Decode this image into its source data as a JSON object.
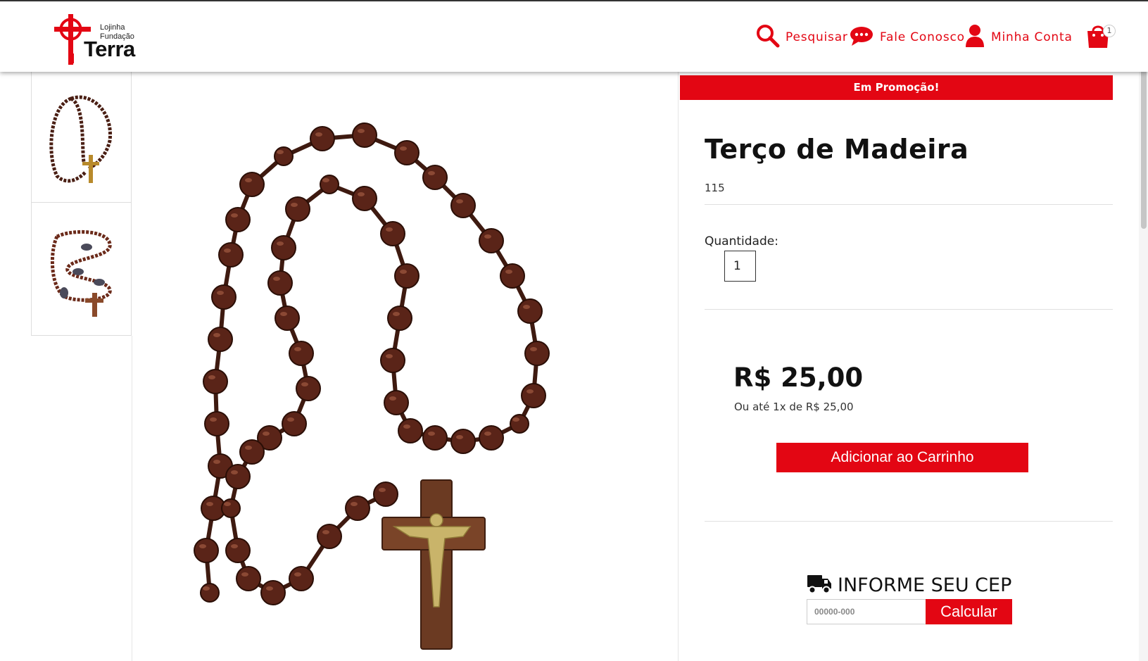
{
  "colors": {
    "accent": "#e30613",
    "wood": "#5a2418"
  },
  "header": {
    "logo": {
      "line1": "Lojinha",
      "line2": "Fundação",
      "line3": "Terra"
    },
    "nav": [
      {
        "label": "Pesquisar",
        "icon": "search-icon"
      },
      {
        "label": "Fale Conosco",
        "icon": "chat-icon"
      },
      {
        "label": "Minha Conta",
        "icon": "user-icon"
      }
    ],
    "cart": {
      "icon": "shopping-bag-icon",
      "count": "1"
    }
  },
  "gallery": {
    "thumbnails": [
      "thumbnail-rosary-wood-1",
      "thumbnail-rosary-wood-2"
    ],
    "main_image": "rosary-wood-photo"
  },
  "product": {
    "promo_label": "Em Promoção!",
    "title": "Terço de Madeira",
    "sku": "115",
    "quantity_label": "Quantidade:",
    "quantity_value": "1",
    "price": "R$ 25,00",
    "installments": "Ou até 1x de R$ 25,00",
    "add_to_cart_label": "Adicionar ao Carrinho"
  },
  "shipping": {
    "title": "INFORME SEU CEP",
    "icon": "truck-icon",
    "cep_placeholder": "00000-000",
    "calculate_label": "Calcular"
  }
}
